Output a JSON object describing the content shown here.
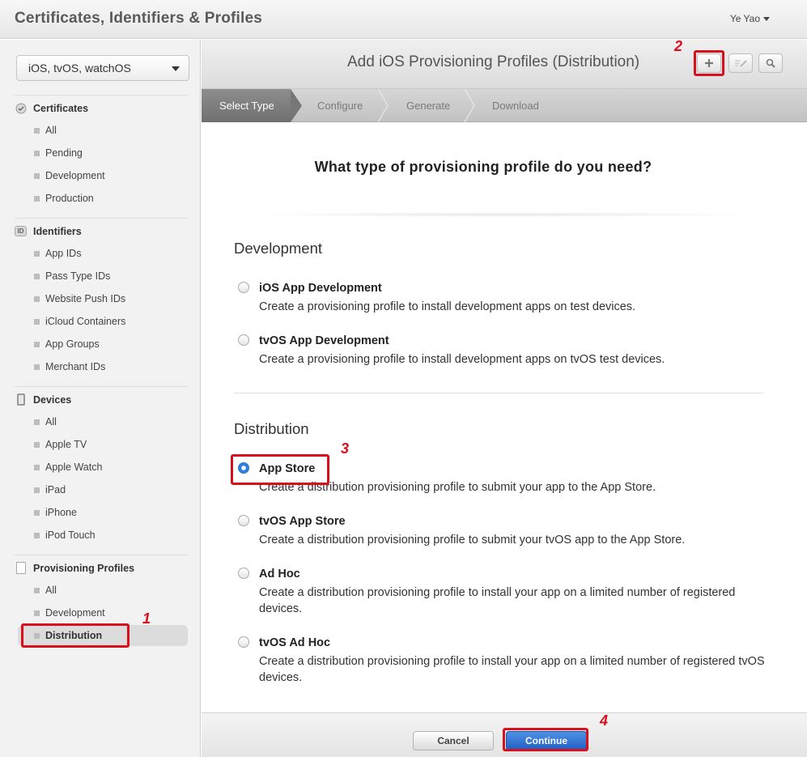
{
  "app": {
    "title": "Certificates, Identifiers & Profiles",
    "user": "Ye Yao"
  },
  "sidebar": {
    "platform": "iOS, tvOS, watchOS",
    "sections": {
      "certificates": {
        "title": "Certificates",
        "items": [
          "All",
          "Pending",
          "Development",
          "Production"
        ]
      },
      "identifiers": {
        "title": "Identifiers",
        "icon_text": "ID",
        "items": [
          "App IDs",
          "Pass Type IDs",
          "Website Push IDs",
          "iCloud Containers",
          "App Groups",
          "Merchant IDs"
        ]
      },
      "devices": {
        "title": "Devices",
        "items": [
          "All",
          "Apple TV",
          "Apple Watch",
          "iPad",
          "iPhone",
          "iPod Touch"
        ]
      },
      "profiles": {
        "title": "Provisioning Profiles",
        "items": [
          "All",
          "Development",
          "Distribution"
        ],
        "selected": "Distribution"
      }
    }
  },
  "main": {
    "title": "Add iOS Provisioning Profiles (Distribution)",
    "steps": [
      "Select Type",
      "Configure",
      "Generate",
      "Download"
    ],
    "active_step": "Select Type",
    "question": "What type of provisioning profile do you need?",
    "development": {
      "title": "Development",
      "options": [
        {
          "label": "iOS App Development",
          "desc": "Create a provisioning profile to install development apps on test devices."
        },
        {
          "label": "tvOS App Development",
          "desc": "Create a provisioning profile to install development apps on tvOS test devices."
        }
      ]
    },
    "distribution": {
      "title": "Distribution",
      "options": [
        {
          "label": "App Store",
          "desc": "Create a distribution provisioning profile to submit your app to the App Store."
        },
        {
          "label": "tvOS App Store",
          "desc": "Create a distribution provisioning profile to submit your tvOS app to the App Store."
        },
        {
          "label": "Ad Hoc",
          "desc": "Create a distribution provisioning profile to install your app on a limited number of registered devices."
        },
        {
          "label": "tvOS Ad Hoc",
          "desc": "Create a distribution provisioning profile to install your app on a limited number of registered tvOS devices."
        }
      ],
      "selected": "App Store"
    },
    "buttons": {
      "cancel": "Cancel",
      "continue": "Continue"
    }
  },
  "annotations": [
    "1",
    "2",
    "3",
    "4"
  ],
  "colors": {
    "annotation_red": "#d9101c",
    "primary_blue": "#2f7fe0"
  }
}
